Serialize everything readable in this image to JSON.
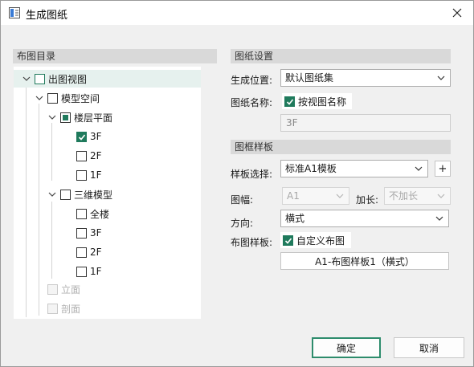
{
  "window": {
    "title": "生成图纸"
  },
  "left": {
    "header": "布图目录",
    "tree": {
      "root": "出图视图",
      "model_space": "模型空间",
      "floor_plan": "楼层平面",
      "floors": [
        "3F",
        "2F",
        "1F"
      ],
      "model_3d": "三维模型",
      "model_3d_items": [
        "全楼",
        "3F",
        "2F",
        "1F"
      ],
      "elevation": "立面",
      "section": "剖面"
    }
  },
  "right": {
    "sheet_settings": {
      "header": "图纸设置",
      "location_label": "生成位置:",
      "location_value": "默认图纸集",
      "name_label": "图纸名称:",
      "name_by_view_label": "按视图名称",
      "name_value": "3F"
    },
    "frame_template": {
      "header": "图框样板",
      "template_label": "样板选择:",
      "template_value": "标准A1模板",
      "add_label": "+",
      "size_label": "图幅:",
      "size_value": "A1",
      "extend_label": "加长:",
      "extend_value": "不加长",
      "orientation_label": "方向:",
      "orientation_value": "横式",
      "layout_label": "布图样板:",
      "custom_layout_label": "自定义布图",
      "layout_template_button": "A1-布图样板1（横式）"
    }
  },
  "footer": {
    "ok_label": "确定",
    "cancel_label": "取消"
  },
  "colors": {
    "accent": "#1f7a5c",
    "selected_row": "#e6f1ee",
    "section_bg": "#d9d9d9"
  }
}
